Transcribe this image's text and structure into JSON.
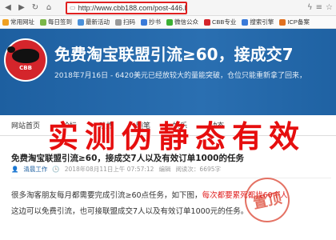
{
  "browser": {
    "url": "http://www.cbb188.com/post-446.html"
  },
  "bookmarks": [
    {
      "label": "常用网址",
      "color": "#f0a020"
    },
    {
      "label": "每日签到",
      "color": "#7ab648"
    },
    {
      "label": "最新活动",
      "color": "#4a90d9"
    },
    {
      "label": "扫码",
      "color": "#999999"
    },
    {
      "label": "抄书",
      "color": "#3a7ad9"
    },
    {
      "label": "微信公众",
      "color": "#3cb034"
    },
    {
      "label": "CBB专业",
      "color": "#d4252b"
    },
    {
      "label": "搜索引擎",
      "color": "#3a7ad9"
    },
    {
      "label": "ICP备案",
      "color": "#e07020"
    }
  ],
  "site": {
    "logo_text": "CBB",
    "title": "免费淘宝联盟引流≥60，接成交7",
    "subtitle": "2018年7月16日 - 6420美元已经放较大的量能突破，仓位只能重新拿了回来，"
  },
  "nav": {
    "items": [
      "网站首页",
      "论坛",
      "吐槽",
      "随笔",
      "娱乐",
      "动态"
    ]
  },
  "overlay_text": "实测伪静态有效",
  "article": {
    "title": "免费淘宝联盟引流≥60，接成交7人以及有效订单1000的任务",
    "author": "清晨工作",
    "date": "2018年08月11日上午 07:57:12",
    "comments": "编辑",
    "views": "阅读次：6695字",
    "stamp": "置顶",
    "para1_a": "很多淘客朋友每月都需要完成引流≥60点任务，如下图，",
    "para1_b": "每次都要累死都找60个人",
    "para2": "这边可以免费引流，也可接联盟成交7人以及有效订单1000元的任务。"
  }
}
